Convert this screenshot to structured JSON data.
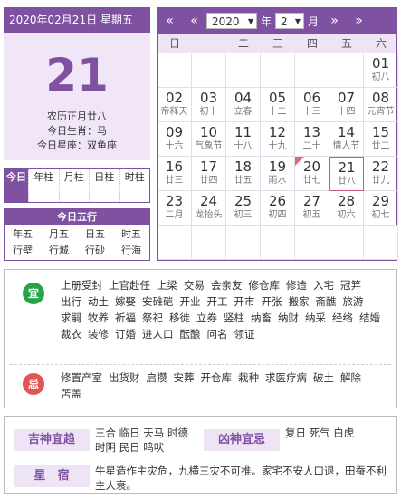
{
  "header": {
    "date_line": "2020年02月21日 星期五",
    "day": "21",
    "lunar_date": "农历正月廿八",
    "zodiac": "今日生肖：马",
    "constellation": "今日星座：双鱼座"
  },
  "tabs": [
    {
      "label": "今日",
      "active": true
    },
    {
      "label": "年柱",
      "active": false
    },
    {
      "label": "月柱",
      "active": false
    },
    {
      "label": "日柱",
      "active": false
    },
    {
      "label": "时柱",
      "active": false
    }
  ],
  "wuxing": {
    "title": "今日五行",
    "cells": [
      "年五",
      "月五",
      "日五",
      "时五",
      "行壁",
      "行城",
      "行砂",
      "行海"
    ]
  },
  "calendar": {
    "year": "2020",
    "year_unit": "年",
    "month": "2",
    "month_unit": "月",
    "nav_prev_year": "«",
    "nav_prev_month": "«",
    "nav_next_month": "»",
    "nav_next_year": "»",
    "weekdays": [
      "日",
      "一",
      "二",
      "三",
      "四",
      "五",
      "六"
    ],
    "days": [
      {
        "g": "",
        "l": ""
      },
      {
        "g": "",
        "l": ""
      },
      {
        "g": "",
        "l": ""
      },
      {
        "g": "",
        "l": ""
      },
      {
        "g": "",
        "l": ""
      },
      {
        "g": "",
        "l": ""
      },
      {
        "g": "01",
        "l": "初八"
      },
      {
        "g": "02",
        "l": "帝释天"
      },
      {
        "g": "03",
        "l": "初十"
      },
      {
        "g": "04",
        "l": "立春"
      },
      {
        "g": "05",
        "l": "十二"
      },
      {
        "g": "06",
        "l": "十三"
      },
      {
        "g": "07",
        "l": "十四"
      },
      {
        "g": "08",
        "l": "元宵节"
      },
      {
        "g": "09",
        "l": "十六"
      },
      {
        "g": "10",
        "l": "气象节"
      },
      {
        "g": "11",
        "l": "十八"
      },
      {
        "g": "12",
        "l": "十九"
      },
      {
        "g": "13",
        "l": "二十"
      },
      {
        "g": "14",
        "l": "情人节"
      },
      {
        "g": "15",
        "l": "廿二"
      },
      {
        "g": "16",
        "l": "廿三"
      },
      {
        "g": "17",
        "l": "廿四"
      },
      {
        "g": "18",
        "l": "廿五"
      },
      {
        "g": "19",
        "l": "雨水"
      },
      {
        "g": "20",
        "l": "廿七"
      },
      {
        "g": "21",
        "l": "廿八"
      },
      {
        "g": "22",
        "l": "廿九"
      },
      {
        "g": "23",
        "l": "二月"
      },
      {
        "g": "24",
        "l": "龙抬头"
      },
      {
        "g": "25",
        "l": "初三"
      },
      {
        "g": "26",
        "l": "初四"
      },
      {
        "g": "27",
        "l": "初五"
      },
      {
        "g": "28",
        "l": "初六"
      },
      {
        "g": "29",
        "l": "初七"
      },
      {
        "g": "",
        "l": ""
      },
      {
        "g": "",
        "l": ""
      },
      {
        "g": "",
        "l": ""
      },
      {
        "g": "",
        "l": ""
      },
      {
        "g": "",
        "l": ""
      },
      {
        "g": "",
        "l": ""
      },
      {
        "g": "",
        "l": ""
      }
    ],
    "today_index": 26,
    "marked_index": 25
  },
  "yi": {
    "badge": "宜",
    "items": [
      "上册受封",
      "上官赴任",
      "上梁",
      "交易",
      "会亲友",
      "修仓库",
      "修造",
      "入宅",
      "冠笄",
      "出行",
      "动土",
      "嫁娶",
      "安碓硙",
      "开业",
      "开工",
      "开市",
      "开张",
      "搬家",
      "斋醮",
      "旅游",
      "求嗣",
      "牧养",
      "祈福",
      "祭祀",
      "移徙",
      "立券",
      "竖柱",
      "纳畜",
      "纳财",
      "纳采",
      "经络",
      "结婚",
      "裁衣",
      "装修",
      "订婚",
      "进人口",
      "酝酿",
      "问名",
      "领证"
    ]
  },
  "ji": {
    "badge": "忌",
    "items": [
      "修置产室",
      "出货财",
      "启攒",
      "安葬",
      "开仓库",
      "栽种",
      "求医疗病",
      "破土",
      "解除",
      "苫盖"
    ]
  },
  "shen": {
    "ji_label": "吉神宜趋",
    "ji_text": "三合 临日 天马 时德 时阴 民日 鸣吠",
    "xiong_label": "凶神宜忌",
    "xiong_text": "复日 死气 白虎",
    "xiu_label": "星　宿",
    "xiu_text": "牛星造作主灾危，九横三灾不可推。家宅不安人口退，田蚕不利主人衰。"
  }
}
